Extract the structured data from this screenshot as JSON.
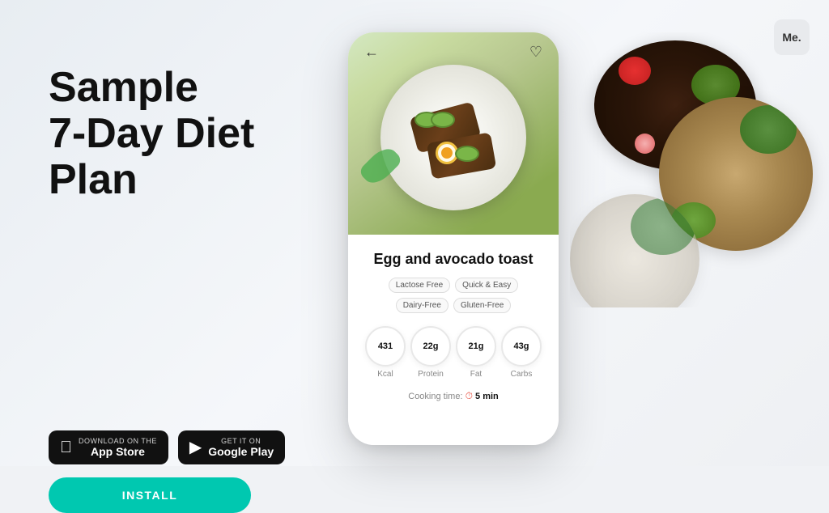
{
  "app": {
    "logo": "Me.",
    "background_color": "#f0f2f5"
  },
  "hero": {
    "title": "Sample\n7-Day Diet\nPlan"
  },
  "store_buttons": [
    {
      "id": "app-store",
      "sub_label": "Download on the",
      "name_label": "App Store",
      "icon": "apple"
    },
    {
      "id": "google-play",
      "sub_label": "GET IT ON",
      "name_label": "Google Play",
      "icon": "android"
    }
  ],
  "install_button": {
    "label": "INSTALL"
  },
  "phone": {
    "nav": {
      "back_icon": "←",
      "favorite_icon": "♡"
    },
    "recipe": {
      "title": "Egg and avocado toast",
      "tags": [
        "Lactose Free",
        "Quick & Easy",
        "Dairy-Free",
        "Gluten-Free"
      ],
      "nutrition": [
        {
          "value": "431",
          "unit": "Kcal"
        },
        {
          "value": "22g",
          "unit": "Protein"
        },
        {
          "value": "21g",
          "unit": "Fat"
        },
        {
          "value": "43g",
          "unit": "Carbs"
        }
      ],
      "cooking_time_label": "Cooking time:",
      "cooking_time_value": "5 min"
    }
  }
}
